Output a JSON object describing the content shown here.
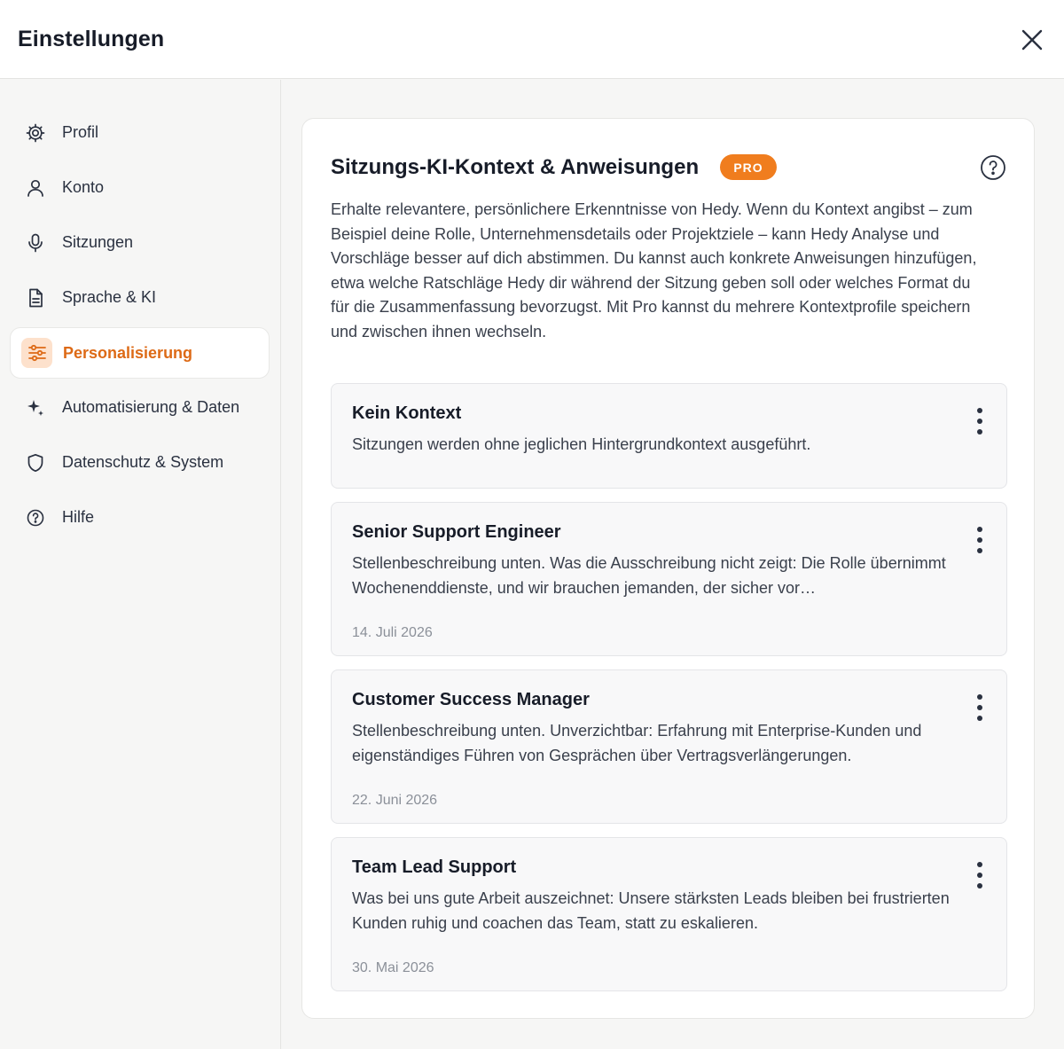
{
  "header": {
    "title": "Einstellungen"
  },
  "sidebar": {
    "items": [
      {
        "label": "Profil",
        "icon": "gear-icon",
        "active": false
      },
      {
        "label": "Konto",
        "icon": "user-icon",
        "active": false
      },
      {
        "label": "Sitzungen",
        "icon": "microphone-icon",
        "active": false
      },
      {
        "label": "Sprache & KI",
        "icon": "document-icon",
        "active": false
      },
      {
        "label": "Personalisierung",
        "icon": "sliders-icon",
        "active": true
      },
      {
        "label": "Automatisierung & Daten",
        "icon": "sparkles-icon",
        "active": false
      },
      {
        "label": "Datenschutz & System",
        "icon": "shield-icon",
        "active": false
      },
      {
        "label": "Hilfe",
        "icon": "help-circle-icon",
        "active": false
      }
    ]
  },
  "main": {
    "title": "Sitzungs-KI-Kontext & Anweisungen",
    "badge": "PRO",
    "description": "Erhalte relevantere, persönlichere Erkenntnisse von Hedy. Wenn du Kontext angibst – zum Beispiel deine Rolle, Unternehmensdetails oder Projektziele – kann Hedy Analyse und Vorschläge besser auf dich abstimmen. Du kannst auch konkrete Anweisungen hinzufügen, etwa welche Ratschläge Hedy dir während der Sitzung geben soll oder welches Format du für die Zusammenfassung bevorzugst. Mit Pro kannst du mehrere Kontextprofile speichern und zwischen ihnen wechseln.",
    "profiles": [
      {
        "title": "Kein Kontext",
        "description": "Sitzungen werden ohne jeglichen Hintergrundkontext ausgeführt.",
        "date": ""
      },
      {
        "title": "Senior Support Engineer",
        "description": "Stellenbeschreibung unten. Was die Ausschreibung nicht zeigt: Die Rolle übernimmt Wochenenddienste, und wir brauchen jemanden, der sicher vor…",
        "date": "14. Juli 2026"
      },
      {
        "title": "Customer Success Manager",
        "description": "Stellenbeschreibung unten. Unverzichtbar: Erfahrung mit Enterprise-Kunden und eigenständiges Führen von Gesprächen über Vertragsverlängerungen.",
        "date": "22. Juni 2026"
      },
      {
        "title": "Team Lead Support",
        "description": "Was bei uns gute Arbeit auszeichnet: Unsere stärksten Leads bleiben bei frustrierten Kunden ruhig und coachen das Team, statt zu eskalieren.",
        "date": "30. Mai 2026"
      }
    ]
  },
  "colors": {
    "accent": "#f07d1e",
    "accent_text": "#dd6a16",
    "accent_bg": "#fde1cc"
  }
}
